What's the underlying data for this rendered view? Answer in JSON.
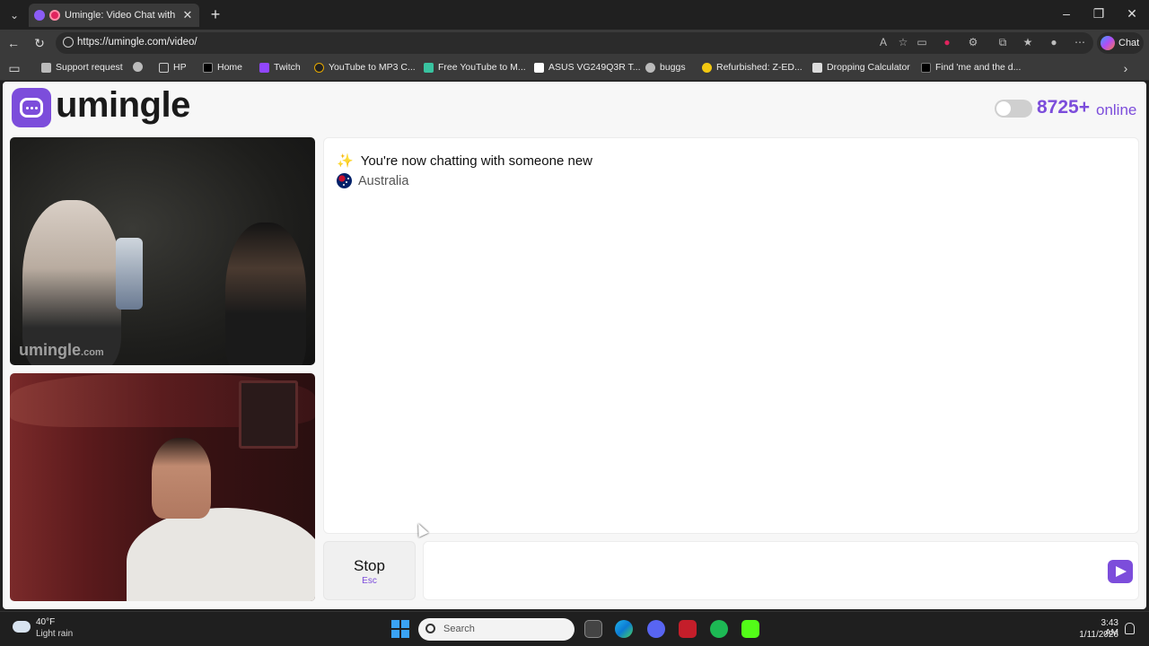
{
  "browser": {
    "tab_title": "Umingle: Video Chat with Stra",
    "url": "https://umingle.com/video/",
    "chat_label": "Chat",
    "bookmarks": [
      {
        "label": "Support request",
        "icon": "document-icon"
      },
      {
        "label": "",
        "icon": "globe-icon"
      },
      {
        "label": "HP",
        "icon": "folder-icon"
      },
      {
        "label": "Home",
        "icon": "x-icon"
      },
      {
        "label": "Twitch",
        "icon": "twitch-icon"
      },
      {
        "label": "YouTube to MP3 C...",
        "icon": "youtube-mp3-icon"
      },
      {
        "label": "Free YouTube to M...",
        "icon": "ytm-icon"
      },
      {
        "label": "ASUS VG249Q3R T...",
        "icon": "notion-icon"
      },
      {
        "label": "buggs",
        "icon": "globe-icon"
      },
      {
        "label": "Refurbished: Z-ED...",
        "icon": "tag-icon"
      },
      {
        "label": "Dropping Calculator",
        "icon": "calculator-icon"
      },
      {
        "label": "Find 'me and the d...",
        "icon": "tiktok-icon"
      }
    ]
  },
  "page": {
    "logo": "umingle",
    "online_count": "8725+",
    "online_label": "online",
    "watermark": "umingle",
    "watermark_suffix": ".com",
    "status_message": "You're now chatting with someone new",
    "country": "Australia",
    "stop_label": "Stop",
    "stop_shortcut": "Esc",
    "message_placeholder": ""
  },
  "taskbar": {
    "weather_temp": "40°F",
    "weather_desc": "Light rain",
    "search_placeholder": "Search",
    "time": "3:43 AM",
    "date": "1/11/2026"
  },
  "colors": {
    "accent": "#7c4ddb",
    "chrome_dark": "#202020",
    "chrome_mid": "#3a3a3a",
    "page_bg": "#f7f7f7"
  }
}
